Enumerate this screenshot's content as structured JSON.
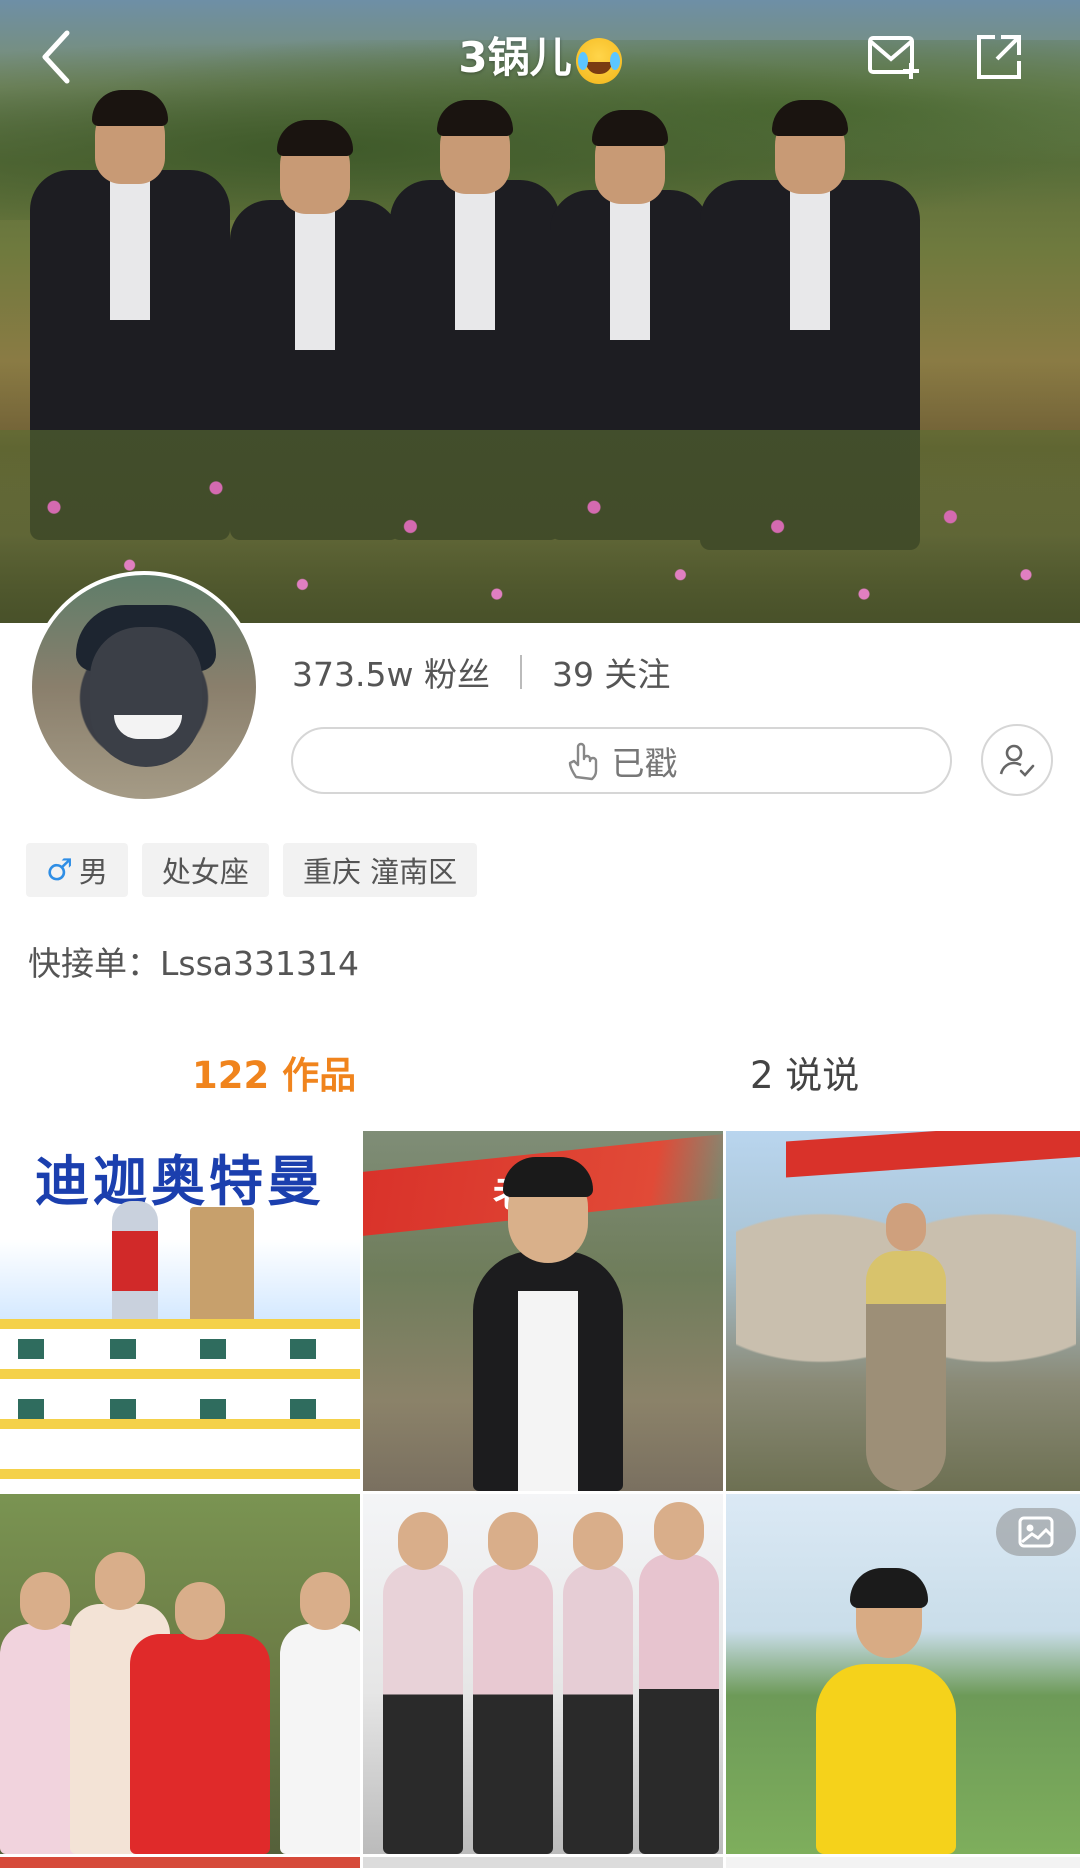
{
  "header": {
    "title": "3锅儿",
    "title_emoji": "tears-of-joy-emoji",
    "back_icon": "chevron-left-icon",
    "message_icon": "mail-plus-icon",
    "share_icon": "share-icon"
  },
  "profile": {
    "followers": "373.5w 粉丝",
    "following": "39 关注",
    "follow_button_label": "已戳",
    "tags": [
      "男",
      "处女座",
      "重庆 潼南区"
    ],
    "gender_symbol": "♂",
    "bio": "快接单：Lssa331314"
  },
  "tabs": {
    "works": "122 作品",
    "posts": "2 说说"
  },
  "grid": {
    "items": [
      {
        "overlay_text": "迪迦奥特曼"
      },
      {
        "overlay_text": "老家"
      },
      {
        "overlay_text": ""
      },
      {
        "overlay_text": ""
      },
      {
        "overlay_text": ""
      },
      {
        "overlay_text": "",
        "badge": "gallery-icon"
      }
    ]
  },
  "colors": {
    "accent": "#f0841d",
    "text": "#555555",
    "tag_bg": "#f2f2f2",
    "male": "#2f8ee5"
  }
}
